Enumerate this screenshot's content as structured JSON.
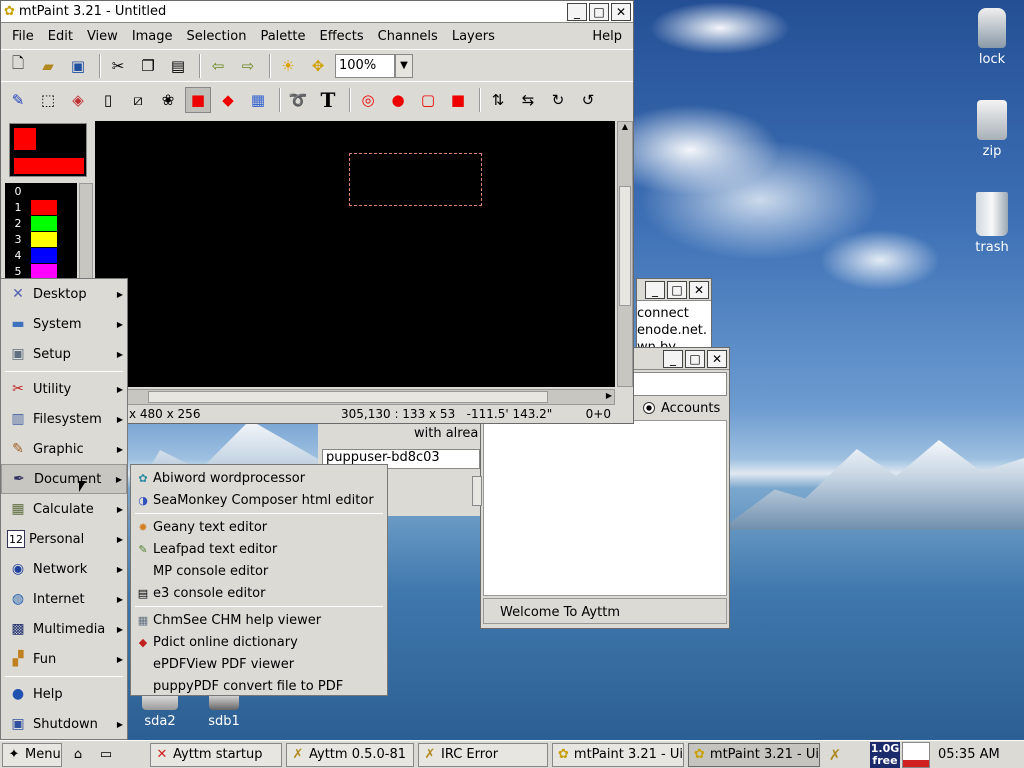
{
  "desktop_icons": [
    {
      "label": "lock"
    },
    {
      "label": "zip"
    },
    {
      "label": "trash"
    },
    {
      "label": "sda2"
    },
    {
      "label": "sdb1"
    }
  ],
  "mtpaint": {
    "title": "mtPaint 3.21 - Untitled",
    "menu": [
      "File",
      "Edit",
      "View",
      "Image",
      "Selection",
      "Palette",
      "Effects",
      "Channels",
      "Layers",
      "Help"
    ],
    "zoom": "100%",
    "palette_numbers": [
      "0",
      "1",
      "2",
      "3",
      "4",
      "5"
    ],
    "palette_colors": [
      "#000000",
      "#ff0000",
      "#00ff00",
      "#ffff00",
      "#0000ff",
      "#ff00ff"
    ],
    "status": {
      "size": "x 480 x 256",
      "coords": "305,130 : 133 x 53   -111.5' 143.2\"",
      "layer": "0+0"
    }
  },
  "bg_window1": {
    "lines": [
      "connect",
      "enode.net.",
      "wn by"
    ]
  },
  "bg_window2": {
    "radio_label": "Accounts",
    "footer": "Welcome To Ayttm"
  },
  "bg_dialog": {
    "text": "with alrea",
    "field": "puppuser-bd8c03"
  },
  "main_menu": {
    "items": [
      "Desktop",
      "System",
      "Setup",
      "Utility",
      "Filesystem",
      "Graphic",
      "Document",
      "Calculate",
      "Personal",
      "Network",
      "Internet",
      "Multimedia",
      "Fun",
      "Help",
      "Shutdown"
    ],
    "personal_icon_text": "12"
  },
  "document_submenu": {
    "items": [
      "Abiword wordprocessor",
      "SeaMonkey Composer html editor",
      "Geany text editor",
      "Leafpad text editor",
      "MP console editor",
      "e3 console editor",
      "ChmSee CHM help viewer",
      "Pdict online dictionary",
      "ePDFView PDF viewer",
      "puppyPDF convert file to PDF"
    ]
  },
  "taskbar": {
    "menu_label": "Menu",
    "tasks": [
      "Ayttm startup",
      "Ayttm 0.5.0-81",
      "IRC Error",
      "mtPaint 3.21 - Ui",
      "mtPaint 3.21 - Ui"
    ],
    "mem": "1.0G",
    "mem_sub": "free",
    "clock": "05:35 AM"
  }
}
